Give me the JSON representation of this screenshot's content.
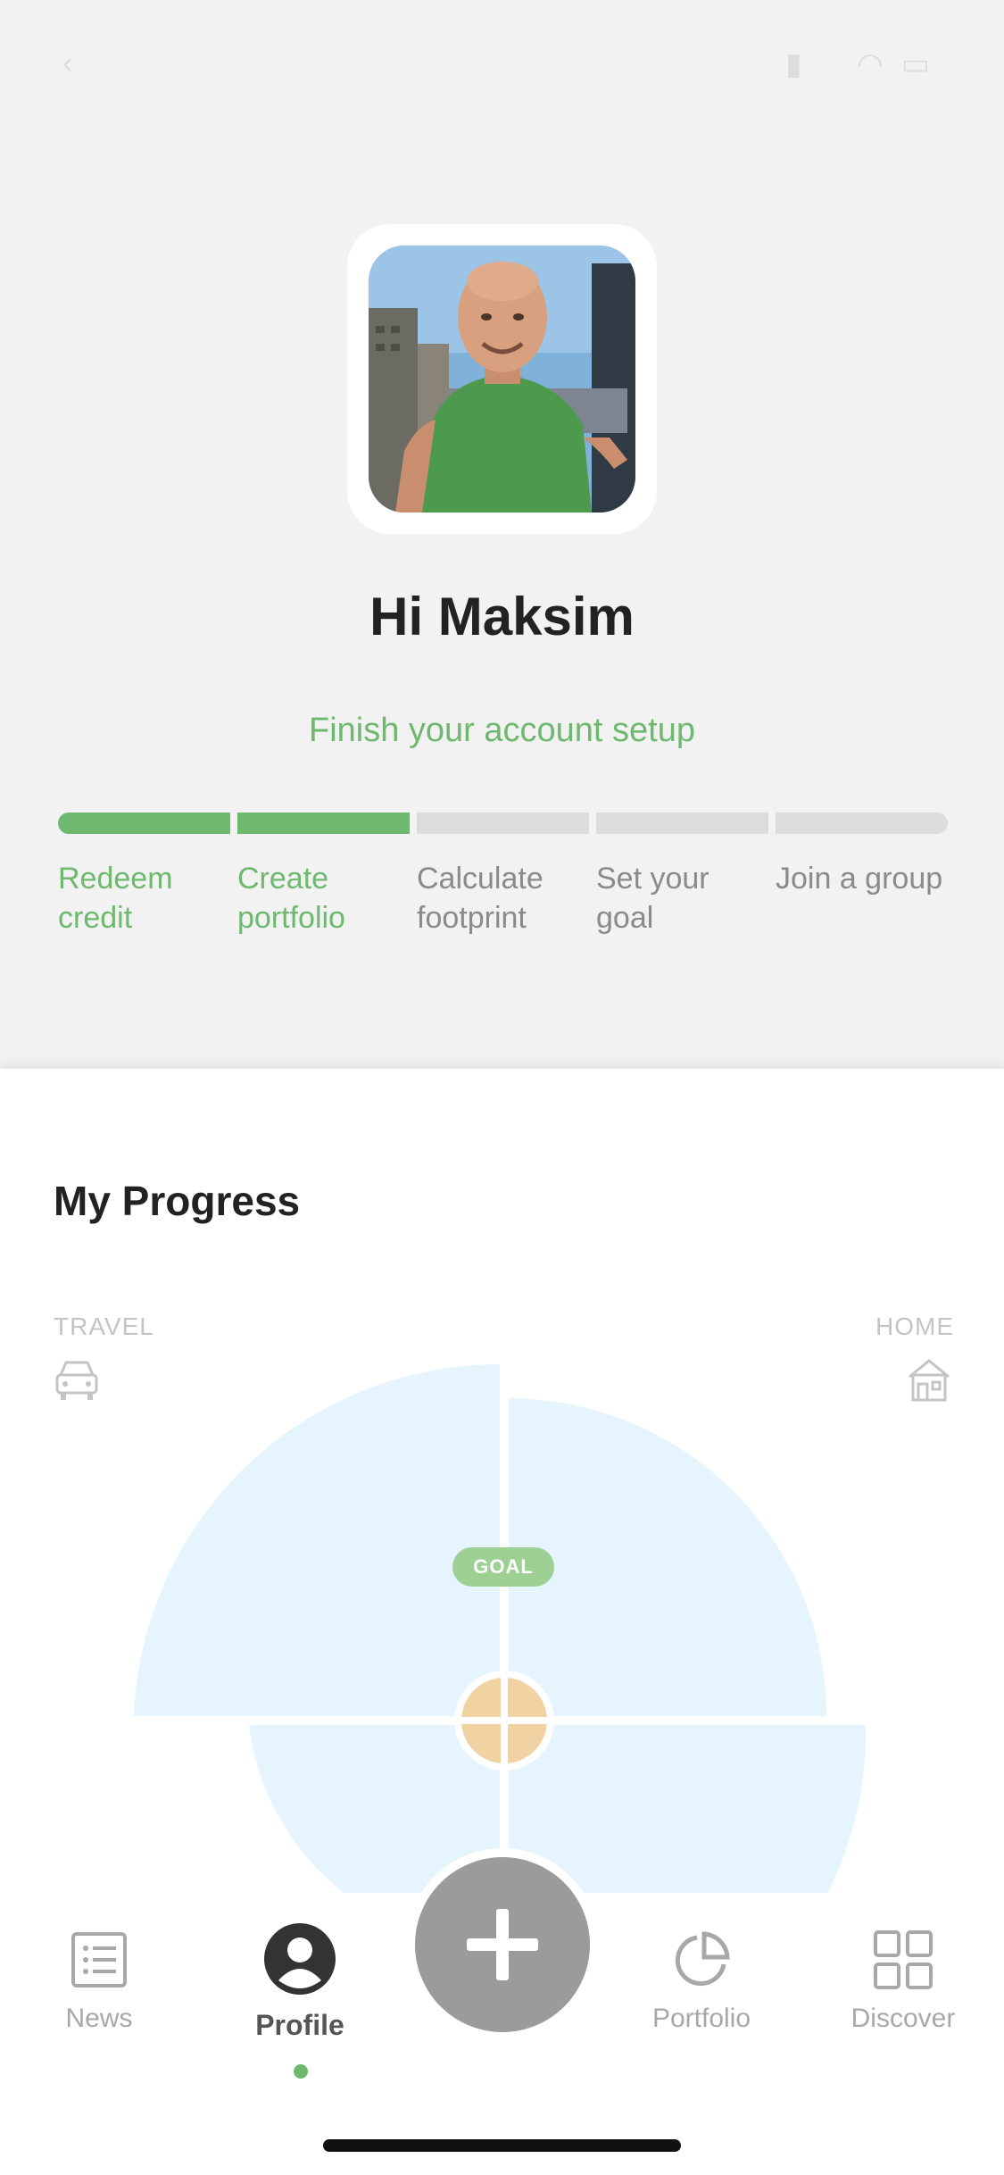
{
  "user": {
    "greeting": "Hi Maksim"
  },
  "setup": {
    "link_text": "Finish your account setup",
    "steps": [
      {
        "label": "Redeem credit",
        "done": true
      },
      {
        "label": "Create portfolio",
        "done": true
      },
      {
        "label": "Calculate footprint",
        "done": false
      },
      {
        "label": "Set your goal",
        "done": false
      },
      {
        "label": "Join a group",
        "done": false
      }
    ]
  },
  "progress": {
    "title": "My Progress",
    "left_category": "TRAVEL",
    "right_category": "HOME",
    "goal_badge": "GOAL"
  },
  "tabs": {
    "news": "News",
    "profile": "Profile",
    "portfolio": "Portfolio",
    "discover": "Discover",
    "active": "profile"
  },
  "colors": {
    "accent_green": "#6fb86f",
    "chart_fill": "#e6f4fd",
    "center_fill": "#f1d3a3",
    "fab": "#9b9b9b"
  }
}
